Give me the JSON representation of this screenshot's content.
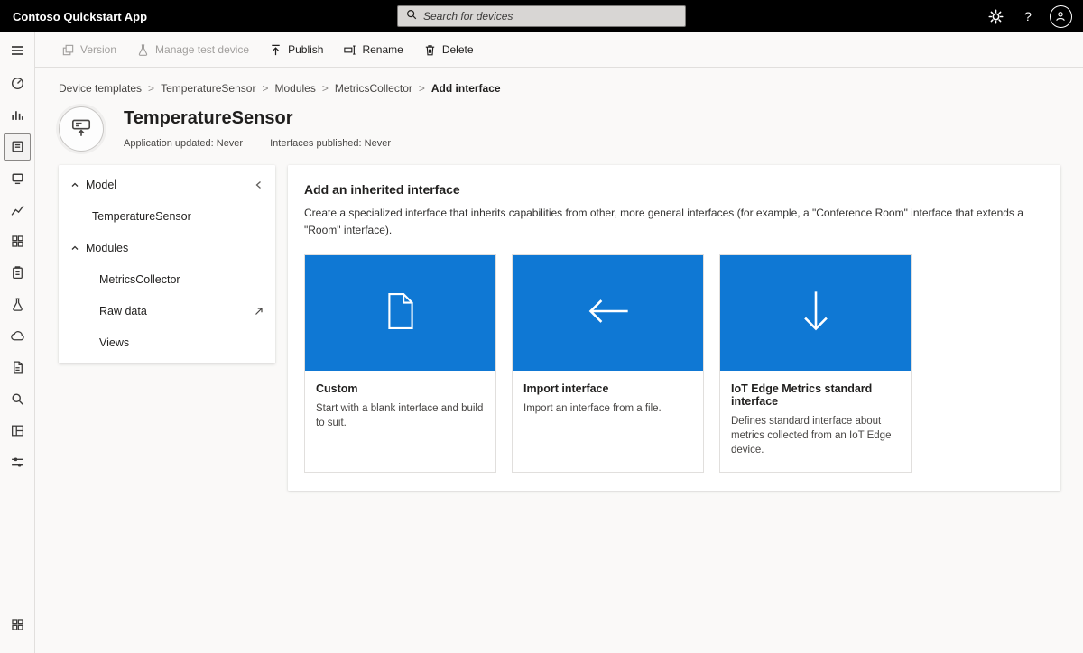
{
  "colors": {
    "accent": "#0f78d4",
    "topbar_bg": "#000000",
    "panel_bg": "#ffffff",
    "app_bg": "#faf9f8"
  },
  "topbar": {
    "app_title": "Contoso Quickstart App",
    "search": {
      "placeholder": "Search for devices",
      "icon": "search-icon"
    },
    "right_icons": [
      "settings-gear-icon",
      "help-icon",
      "account-avatar-icon"
    ],
    "help_label": "?"
  },
  "sidenav": {
    "icons": [
      "menu-icon",
      "dashboard-gauge-icon",
      "analytics-bars-icon",
      "device-templates-icon",
      "devices-icon",
      "data-explorer-chart-icon",
      "device-groups-icon",
      "jobs-clipboard-icon",
      "rules-beaker-icon",
      "data-export-cloud-icon",
      "audit-log-icon",
      "search-wrench-icon",
      "edge-manifests-icon",
      "administration-icon",
      "app-grid-icon"
    ],
    "selected": "device-templates-icon"
  },
  "toolbar": {
    "items": [
      {
        "label": "Version",
        "icon": "version-icon",
        "disabled": true
      },
      {
        "label": "Manage test device",
        "icon": "test-device-icon",
        "disabled": true
      },
      {
        "label": "Publish",
        "icon": "publish-icon",
        "disabled": false
      },
      {
        "label": "Rename",
        "icon": "rename-icon",
        "disabled": false
      },
      {
        "label": "Delete",
        "icon": "delete-icon",
        "disabled": false
      }
    ]
  },
  "breadcrumb": {
    "separator": ">",
    "items": [
      "Device templates",
      "TemperatureSensor",
      "Modules",
      "MetricsCollector",
      "Add interface"
    ]
  },
  "header": {
    "title": "TemperatureSensor",
    "meta": [
      "Application updated: Never",
      "Interfaces published: Never"
    ]
  },
  "tree": {
    "items": [
      {
        "label": "Model",
        "type": "group"
      },
      {
        "label": "TemperatureSensor",
        "type": "leaf"
      },
      {
        "label": "Modules",
        "type": "group"
      },
      {
        "label": "MetricsCollector",
        "type": "leaf"
      },
      {
        "label": "Raw data",
        "type": "leaf-external"
      },
      {
        "label": "Views",
        "type": "leaf"
      }
    ]
  },
  "panel": {
    "title": "Add an inherited interface",
    "description": "Create a specialized interface that inherits capabilities from other, more general interfaces (for example, a \"Conference Room\" interface that extends a \"Room\" interface).",
    "cards": [
      {
        "title": "Custom",
        "description": "Start with a blank interface and build to suit.",
        "icon": "blank-document-icon"
      },
      {
        "title": "Import interface",
        "description": "Import an interface from a file.",
        "icon": "arrow-left-icon"
      },
      {
        "title": "IoT Edge Metrics standard interface",
        "description": "Defines standard interface about metrics collected from an IoT Edge device.",
        "icon": "arrow-down-icon"
      }
    ]
  }
}
